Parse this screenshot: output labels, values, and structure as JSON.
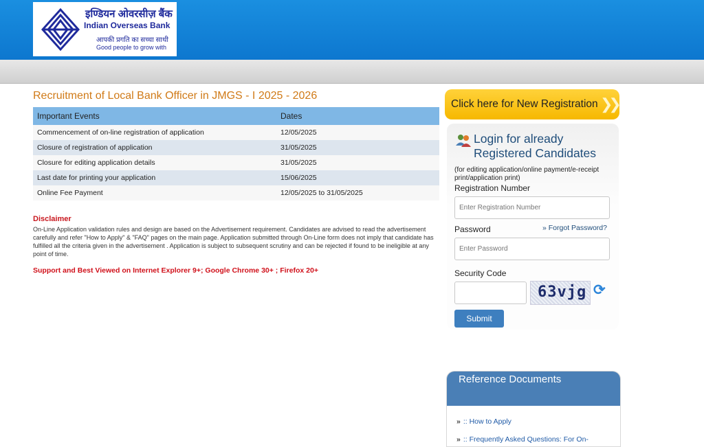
{
  "brand": {
    "name_hindi": "इण्डियन ओवरसीज़ बैंक",
    "name_english": "Indian Overseas Bank",
    "tagline_hindi": "आपकी प्रगति का सच्चा साथी",
    "tagline_english": "Good people to grow with"
  },
  "main": {
    "title": "Recruitment of Local Bank Officer in JMGS - I 2025 - 2026",
    "table": {
      "headers": [
        "Important Events",
        "Dates"
      ],
      "rows": [
        [
          "Commencement of on-line registration of application",
          "12/05/2025"
        ],
        [
          "Closure of registration of application",
          "31/05/2025"
        ],
        [
          "Closure for editing application details",
          "31/05/2025"
        ],
        [
          "Last date for printing your application",
          "15/06/2025"
        ],
        [
          "Online Fee Payment",
          "12/05/2025 to 31/05/2025"
        ]
      ]
    },
    "disclaimer_title": "Disclaimer",
    "disclaimer_text": "On-Line Application validation rules and design are based on the Advertisement requirement. Candidates are advised to read the advertisement carefully and refer \"How to Apply\" & \"FAQ\" pages on the main page. Application submitted through On-Line form does not imply that candidate has fulfilled all the criteria given in the advertisement . Application is subject to subsequent scrutiny and can be rejected if found to be ineligible at any point of time.",
    "support_note": "Support and Best Viewed on Internet Explorer 9+; Google Chrome 30+ ; Firefox 20+"
  },
  "sidebar": {
    "new_registration": "Click here for New Registration",
    "login": {
      "title_line1": "Login for already",
      "title_line2": "Registered Candidates",
      "note": "(for editing application/online payment/e-receipt print/application print)",
      "reg_label": "Registration Number",
      "reg_placeholder": "Enter Registration Number",
      "password_label": "Password",
      "forgot": "Forgot Password?",
      "password_placeholder": "Enter Password",
      "security_label": "Security Code",
      "captcha_text": "63vjg",
      "submit": "Submit"
    },
    "reference": {
      "title": "Reference Documents",
      "items": [
        ":: How to Apply",
        ":: Frequently Asked Questions: For On-"
      ]
    }
  },
  "colors": {
    "header_blue": "#0d77cf",
    "title_orange": "#d07a17",
    "table_header": "#7fb7e5",
    "alert_red": "#d0101a",
    "cta_yellow": "#f6b800",
    "button_blue": "#3e7fbf"
  },
  "icons": {
    "logo": "iob-logo-icon",
    "login": "users-icon",
    "refresh": "refresh-icon",
    "bullet": "double-chevron-icon"
  }
}
